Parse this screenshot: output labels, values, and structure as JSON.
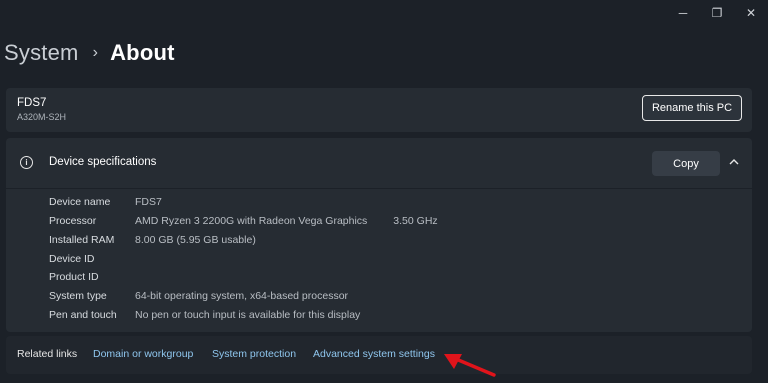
{
  "window_controls": {
    "minimize": "─",
    "maximize": "❐",
    "close": "✕"
  },
  "breadcrumb": {
    "root": "System",
    "separator": "›",
    "current": "About"
  },
  "pc": {
    "name": "FDS7",
    "model": "A320M-S2H",
    "rename_label": "Rename this PC"
  },
  "specs": {
    "title": "Device specifications",
    "copy_label": "Copy",
    "rows": [
      {
        "label": "Device name",
        "value": "FDS7",
        "extra": ""
      },
      {
        "label": "Processor",
        "value": "AMD Ryzen 3 2200G with Radeon Vega Graphics",
        "extra": "3.50 GHz"
      },
      {
        "label": "Installed RAM",
        "value": "8.00 GB (5.95 GB usable)",
        "extra": ""
      },
      {
        "label": "Device ID",
        "value": "",
        "extra": ""
      },
      {
        "label": "Product ID",
        "value": "",
        "extra": ""
      },
      {
        "label": "System type",
        "value": "64-bit operating system, x64-based processor",
        "extra": ""
      },
      {
        "label": "Pen and touch",
        "value": "No pen or touch input is available for this display",
        "extra": ""
      }
    ]
  },
  "related": {
    "label": "Related links",
    "links": [
      "Domain or workgroup",
      "System protection",
      "Advanced system settings"
    ]
  },
  "colors": {
    "background": "#1c2128",
    "card": "#262c33",
    "link": "#8fc6ee",
    "annotation_arrow": "#e0141b"
  },
  "icons": {
    "info": "info-icon",
    "collapse": "chevron-up-icon",
    "annotation": "red-arrow-icon"
  }
}
